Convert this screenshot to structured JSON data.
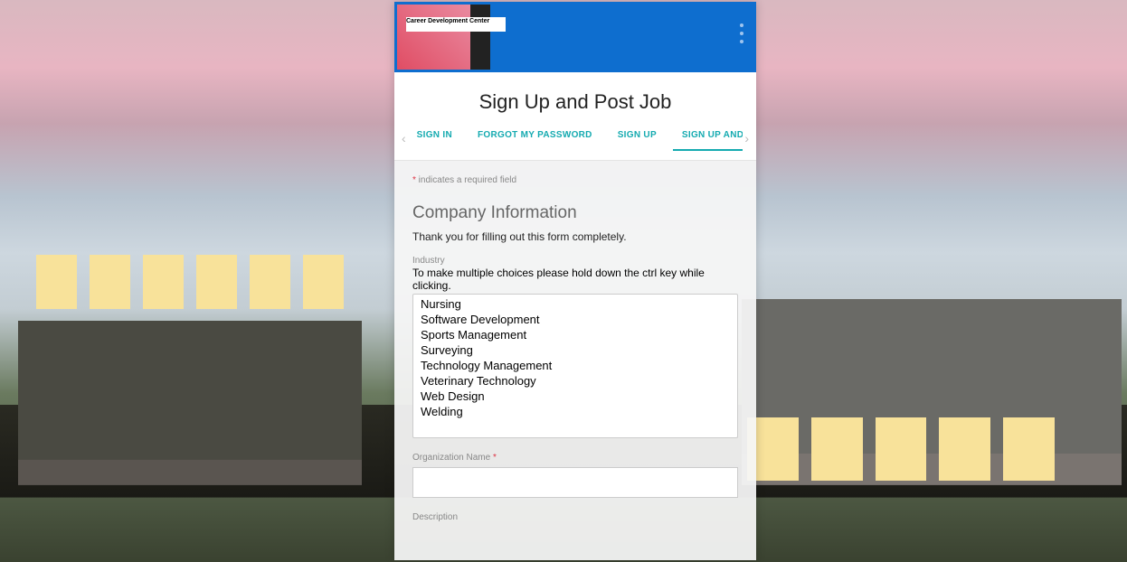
{
  "header": {
    "logo_text": "Career Development Center"
  },
  "title": "Sign Up and Post Job",
  "tabs": {
    "items": [
      {
        "label": "SIGN IN",
        "active": false
      },
      {
        "label": "FORGOT MY PASSWORD",
        "active": false
      },
      {
        "label": "SIGN UP",
        "active": false
      },
      {
        "label": "SIGN UP AND POS",
        "active": true
      }
    ]
  },
  "form": {
    "required_note_prefix": "*",
    "required_note": " indicates a required field",
    "section_heading": "Company Information",
    "thanks": "Thank you for filling out this form completely.",
    "industry_label": "Industry",
    "industry_hint": "To make multiple choices please hold down the ctrl key while clicking.",
    "industry_options": [
      "Nursing",
      "Software Development",
      "Sports Management",
      "Surveying",
      "Technology Management",
      "Veterinary Technology",
      "Web Design",
      "Welding"
    ],
    "org_name_label": "Organization Name ",
    "org_name_required": "*",
    "org_name_value": "",
    "description_label": "Description"
  }
}
